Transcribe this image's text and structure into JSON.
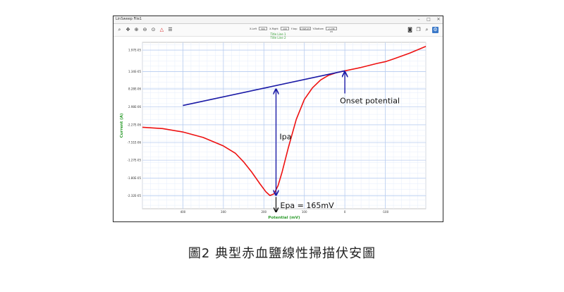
{
  "window": {
    "title": "LinSweep File1"
  },
  "toolbar": {
    "fields": [
      {
        "label": "X-Left",
        "value": "500"
      },
      {
        "label": "X-Right",
        "value": "-100"
      },
      {
        "label": "Y-top",
        "value": "2.39E-05"
      },
      {
        "label": "Y-Bottom",
        "value": "-2.23E-05"
      }
    ],
    "icons_left": [
      "magnifier-icon",
      "move-icon",
      "zoom-in-icon",
      "zoom-out-icon",
      "zoom-reset-icon",
      "peak-icon",
      "list-icon"
    ],
    "icons_right": [
      "camera-icon",
      "copy-icon",
      "search-icon",
      "settings-icon"
    ]
  },
  "plot_titles": {
    "line1": "Title Line 1",
    "line2": "Title Line 2"
  },
  "chart_data": {
    "type": "line",
    "xlabel": "Potential (mV)",
    "ylabel": "Current (A)",
    "xlim": [
      500,
      -200
    ],
    "ylim": [
      -2.7e-05,
      2.2e-05
    ],
    "x_ticks": [
      "400",
      "300",
      "200",
      "100",
      "0",
      "-100"
    ],
    "x_tick_values": [
      400,
      300,
      200,
      100,
      0,
      -100
    ],
    "y_ticks": [
      "1.97E-05",
      "1.34E-05",
      "8.28E-06",
      "2.98E-06",
      "-2.27E-06",
      "-7.51E-06",
      "-1.27E-05",
      "-1.80E-05",
      "-2.32E-05"
    ],
    "y_tick_values": [
      1.97e-05,
      1.34e-05,
      8.28e-06,
      2.98e-06,
      -2.27e-06,
      -7.51e-06,
      -1.27e-05,
      -1.8e-05,
      -2.32e-05
    ],
    "grid": true,
    "series": [
      {
        "color": "#ee1111",
        "x": [
          500,
          450,
          400,
          350,
          300,
          270,
          250,
          230,
          210,
          195,
          185,
          175,
          165,
          155,
          140,
          120,
          100,
          80,
          60,
          40,
          20,
          0,
          -40,
          -80,
          -100,
          -120,
          -160,
          -200
        ],
        "y": [
          -3e-06,
          -3.4e-06,
          -4.4e-06,
          -6e-06,
          -8.5e-06,
          -1.07e-05,
          -1.32e-05,
          -1.62e-05,
          -1.96e-05,
          -2.2e-05,
          -2.31e-05,
          -2.26e-05,
          -2.02e-05,
          -1.62e-05,
          -9.2e-06,
          -7e-07,
          5.2e-06,
          8.6e-06,
          1.09e-05,
          1.23e-05,
          1.31e-05,
          1.36e-05,
          1.46e-05,
          1.58e-05,
          1.63e-05,
          1.71e-05,
          1.88e-05,
          2.08e-05
        ]
      },
      {
        "color": "#1a1aa6",
        "x": [
          400,
          0
        ],
        "y": [
          3.4e-06,
          1.36e-05
        ]
      }
    ],
    "annotations": {
      "ipa_label": "Ipa",
      "onset_label": "Onset potential",
      "epa_label": "Epa = 165mV",
      "ipa_x": 170,
      "ipa_top_y": 8.3e-06,
      "ipa_bottom_y": -2.31e-05,
      "onset_x": 0,
      "onset_y": 1.36e-05,
      "annotation_color": "#1a1aa6"
    }
  },
  "caption": "圖2 典型赤血鹽線性掃描伏安圖"
}
